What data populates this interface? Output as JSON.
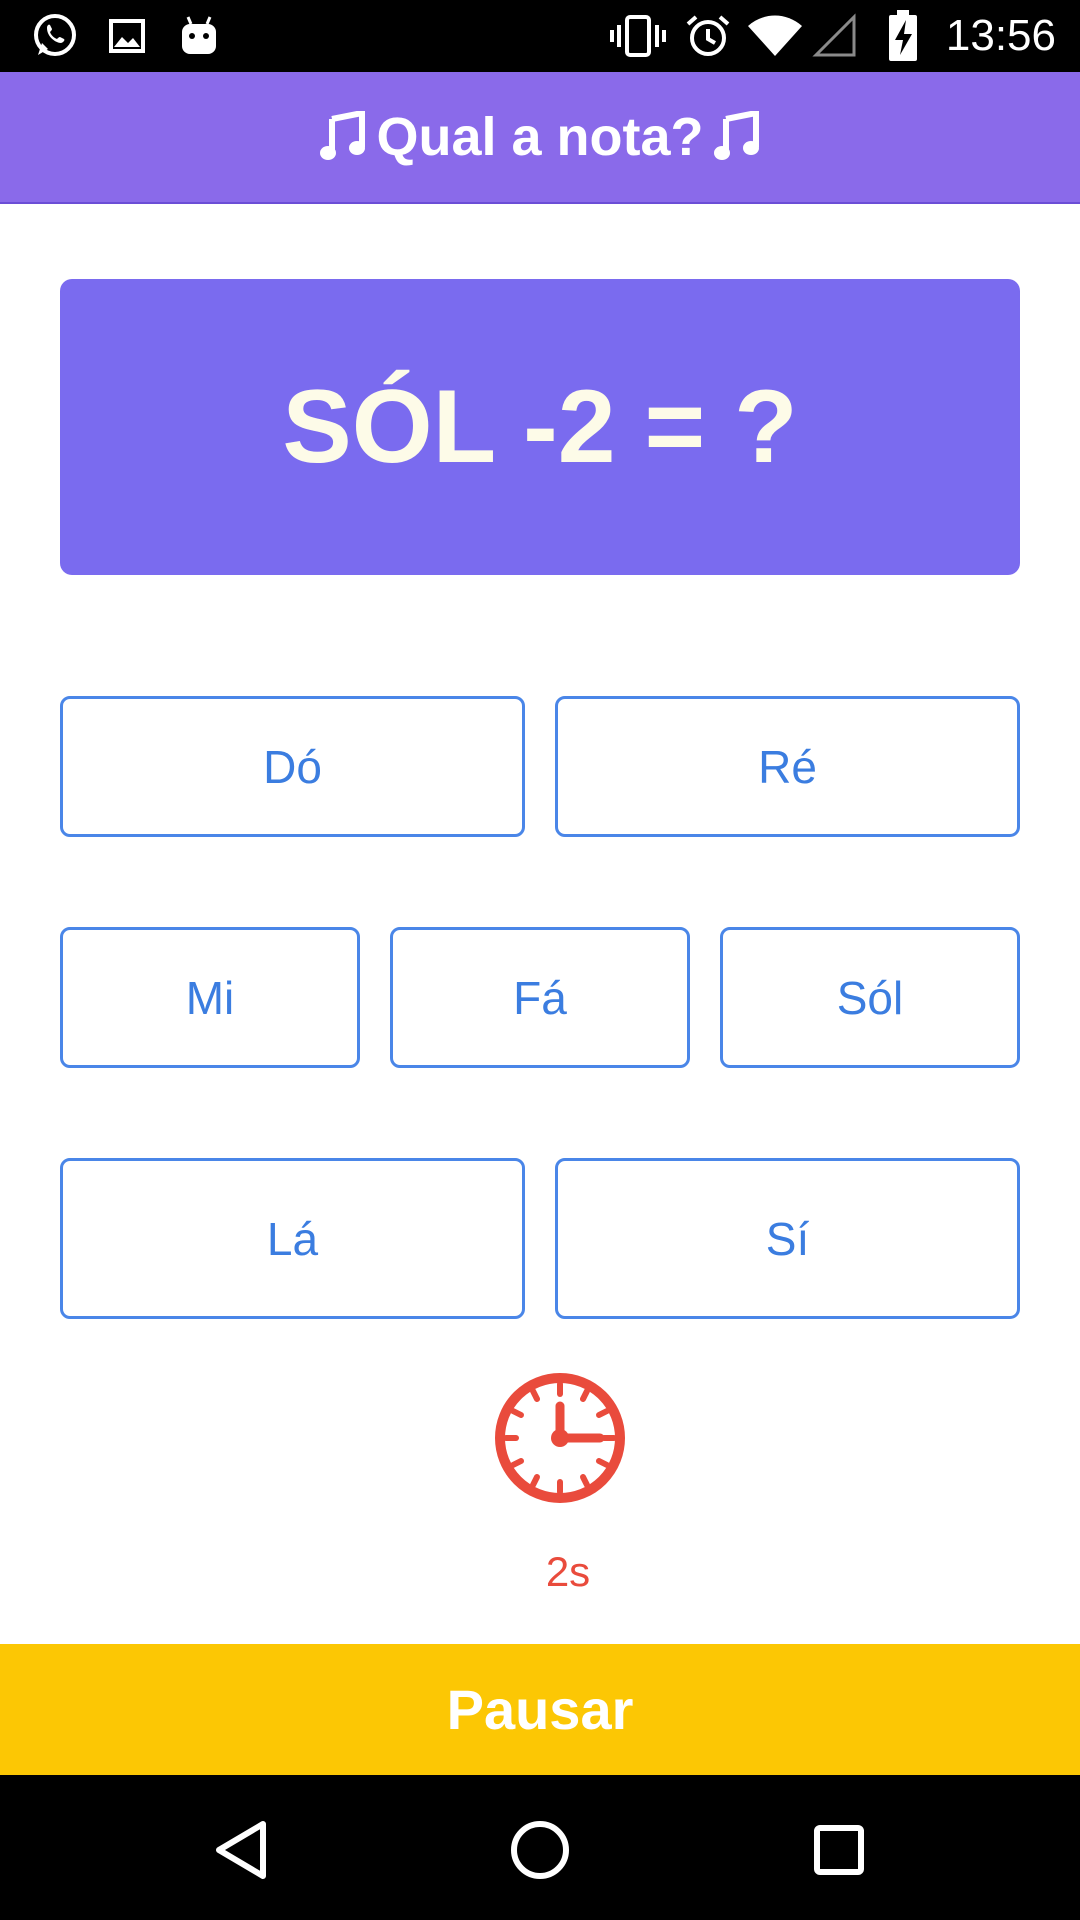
{
  "status_bar": {
    "time": "13:56",
    "icons": [
      "whatsapp-icon",
      "gallery-icon",
      "android-icon",
      "vibrate-icon",
      "alarm-icon",
      "wifi-icon",
      "signal-icon",
      "battery-charging-icon"
    ]
  },
  "app_bar": {
    "title": "Qual a nota?",
    "note_icon": "music-note-icon"
  },
  "question": {
    "text": "SÓL -2 = ?"
  },
  "answers": {
    "row1": [
      "Dó",
      "Ré"
    ],
    "row2": [
      "Mi",
      "Fá",
      "Sól"
    ],
    "row3": [
      "Lá",
      "Sí"
    ]
  },
  "timer": {
    "icon": "clock-icon",
    "value": "2s"
  },
  "pause_button": {
    "label": "Pausar"
  },
  "nav_bar": {
    "icons": [
      "back-icon",
      "home-icon",
      "recents-icon"
    ]
  },
  "colors": {
    "app_bar": "#8a6aea",
    "question_card": "#7a6bef",
    "answer_border": "#4a86e8",
    "answer_text": "#3b7de0",
    "timer": "#e94b3c",
    "pause_button": "#fcc704"
  }
}
